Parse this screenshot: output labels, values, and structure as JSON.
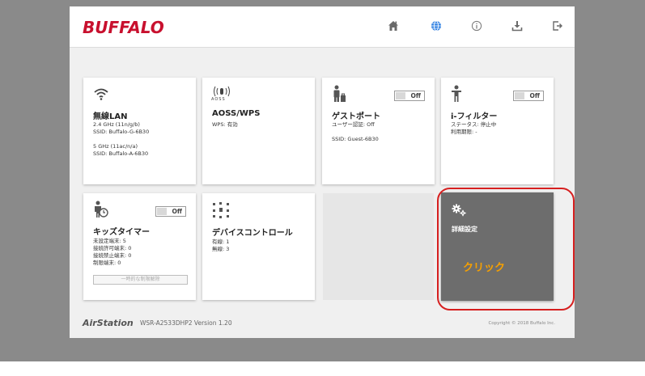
{
  "brand": "BUFFALO",
  "header": {
    "icons": [
      "home-icon",
      "globe-icon",
      "info-icon",
      "download-icon",
      "logout-icon"
    ]
  },
  "tiles": {
    "wlan": {
      "title": "無線LAN",
      "info": "2.4 GHz (11n/g/b)\nSSID: Buffalo-G-6B30\n\n5 GHz (11ac/n/a)\nSSID: Buffalo-A-6B30"
    },
    "aoss": {
      "icon_label": "AOSS",
      "title": "AOSS/WPS",
      "info": "WPS: 有効"
    },
    "guest": {
      "title": "ゲストポート",
      "info": "ユーザー認証: Off\n\nSSID: Guest-6B30",
      "toggle": "Off"
    },
    "ifilter": {
      "title": "i-フィルター",
      "info": "ステータス: 停止中\n利用期限: -",
      "toggle": "Off"
    },
    "kids": {
      "title": "キッズタイマー",
      "info": "未設定端末: 5\n接続許可端末: 0\n接続禁止端末: 0\n制限端末: 0",
      "toggle": "Off",
      "button": "一時的な制限解除"
    },
    "device": {
      "title": "デバイスコントロール",
      "info": "有線: 1\n無線: 3"
    },
    "advanced": {
      "title": "詳細設定",
      "annotation": "クリック"
    }
  },
  "footer": {
    "airstation": "AirStation",
    "model": "WSR-A2533DHP2  Version 1.20",
    "copyright": "Copyright © 2018 Buffalo Inc."
  },
  "colors": {
    "brand": "#c8102e",
    "highlight_ring": "#d61f1f",
    "annotation": "#f6a000",
    "active_icon": "#2a7de1"
  }
}
